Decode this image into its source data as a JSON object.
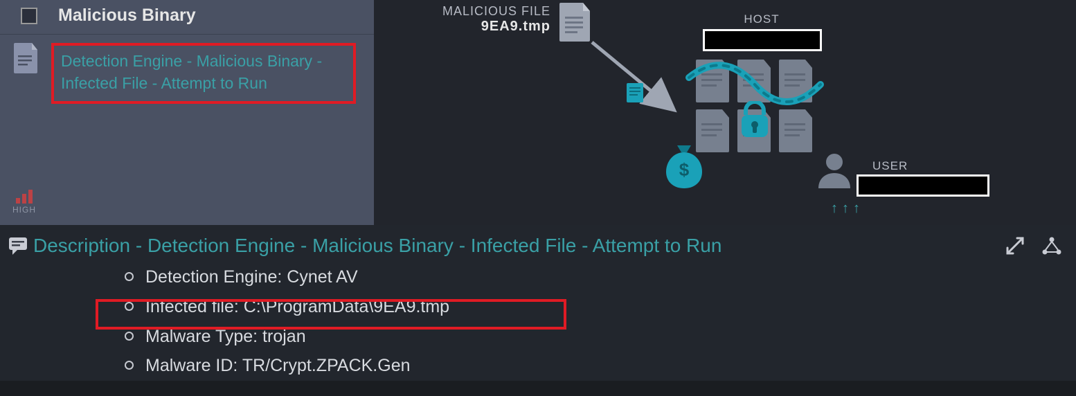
{
  "panel": {
    "title": "Malicious Binary",
    "detection_text": "Detection Engine - Malicious Binary - Infected File - Attempt to Run",
    "severity": "HIGH"
  },
  "graph": {
    "malicious_file_label": "MALICIOUS FILE",
    "malicious_file_name": "9EA9.tmp",
    "host_label": "HOST",
    "user_label": "USER"
  },
  "description": {
    "heading": "Description - Detection Engine - Malicious Binary - Infected File - Attempt to Run",
    "items": [
      "Detection Engine: Cynet AV",
      "Infected file: C:\\ProgramData\\9EA9.tmp",
      "Malware Type: trojan",
      "Malware ID: TR/Crypt.ZPACK.Gen"
    ]
  }
}
